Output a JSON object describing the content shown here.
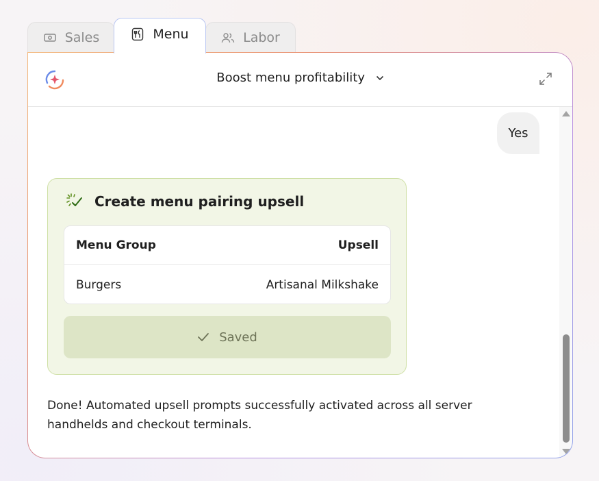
{
  "tabs": [
    {
      "label": "Sales",
      "icon": "money-icon",
      "active": false
    },
    {
      "label": "Menu",
      "icon": "utensils-icon",
      "active": true
    },
    {
      "label": "Labor",
      "icon": "people-icon",
      "active": false
    }
  ],
  "header": {
    "title": "Boost menu profitability",
    "logo_icon": "ai-assistant-logo",
    "expand_icon": "expand-icon"
  },
  "chat": {
    "user_message": "Yes",
    "action": {
      "title": "Create menu pairing upsell",
      "columns": [
        "Menu Group",
        "Upsell"
      ],
      "rows": [
        [
          "Burgers",
          "Artisanal Milkshake"
        ]
      ],
      "status_label": "Saved"
    },
    "assistant_reply": "Done! Automated upsell prompts successfully activated across all server handhelds and checkout terminals."
  },
  "colors": {
    "action_bg": "#f2f6e6",
    "action_border": "#cfe0a6",
    "saved_bg": "#dde5c6",
    "spark_green": "#5f8f1f"
  }
}
